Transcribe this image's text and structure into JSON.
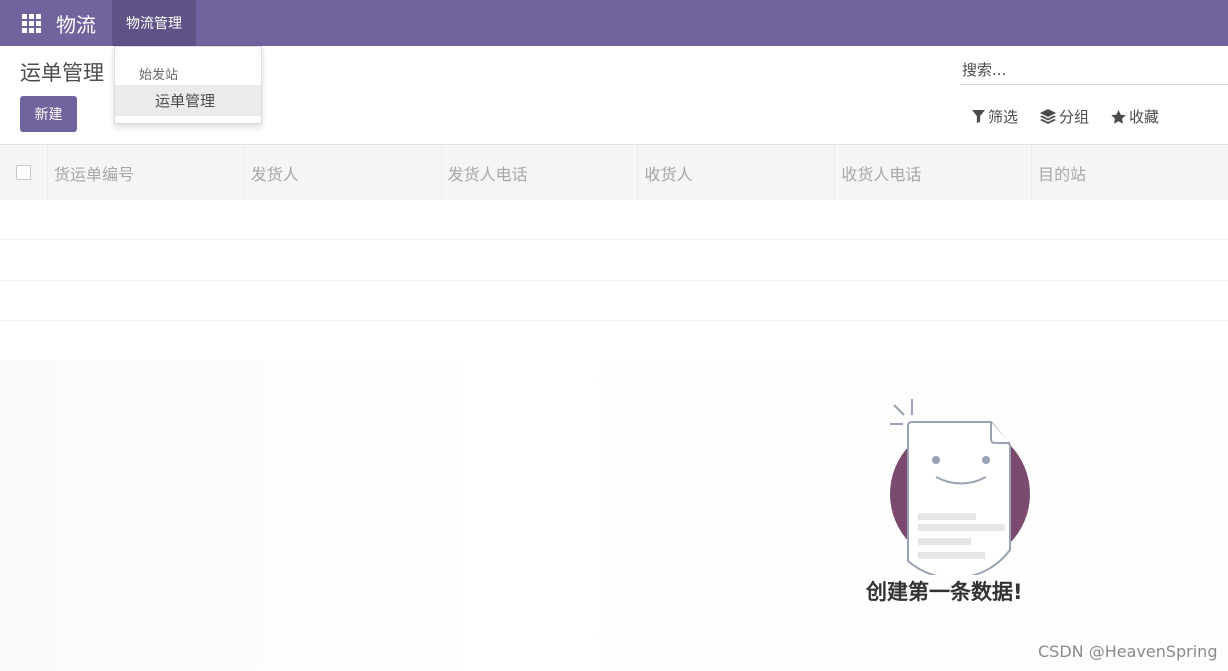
{
  "navbar": {
    "brand": "物流",
    "menu_label": "物流管理",
    "color": "#71639e"
  },
  "dropdown": {
    "header": "始发站",
    "item": "运单管理"
  },
  "control_panel": {
    "title": "运单管理",
    "new_button": "新建",
    "search_placeholder": "搜索...",
    "filter": "筛选",
    "group": "分组",
    "favorite": "收藏"
  },
  "table": {
    "columns": [
      "货运单编号",
      "发货人",
      "发货人电话",
      "收货人",
      "收货人电话",
      "目的站"
    ]
  },
  "empty_state": {
    "title": "创建第一条数据!"
  },
  "watermark": "CSDN @HeavenSpring"
}
